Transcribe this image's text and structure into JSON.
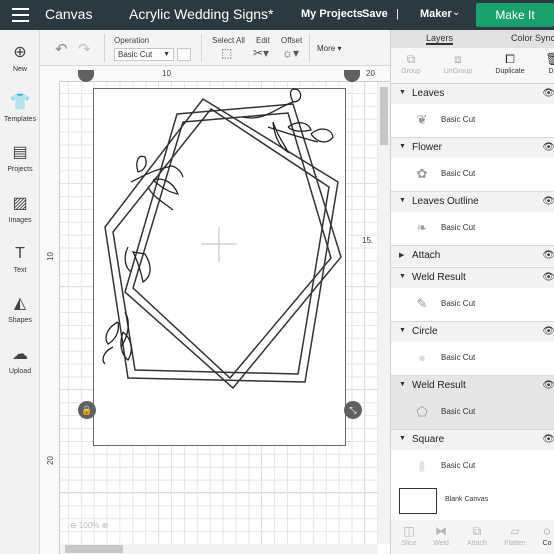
{
  "topbar": {
    "section_title": "Canvas",
    "document_title": "Acrylic Wedding Signs*",
    "my_projects": "My Projects",
    "save": "Save",
    "separator": "|",
    "machine": "Maker",
    "make_it": "Make It"
  },
  "toolbar": {
    "operation_label": "Operation",
    "operation_value": "Basic Cut",
    "select_all": "Select All",
    "edit": "Edit",
    "offset": "Offset",
    "more": "More"
  },
  "leftbar": {
    "items": [
      {
        "label": "New",
        "icon": "plus-circle-icon"
      },
      {
        "label": "Templates",
        "icon": "shirt-icon"
      },
      {
        "label": "Projects",
        "icon": "projects-icon"
      },
      {
        "label": "Images",
        "icon": "image-icon"
      },
      {
        "label": "Text",
        "icon": "text-icon"
      },
      {
        "label": "Shapes",
        "icon": "shapes-icon"
      },
      {
        "label": "Upload",
        "icon": "upload-icon"
      }
    ]
  },
  "rulers": {
    "top": [
      "10",
      "20"
    ],
    "left": [
      "10",
      "20"
    ]
  },
  "canvas": {
    "position_label": "15.",
    "zoom": "100%"
  },
  "panel": {
    "tabs": [
      "Layers",
      "Color Sync"
    ],
    "actions": [
      "Group",
      "UnGroup",
      "Duplicate",
      "De"
    ],
    "layers": [
      {
        "name": "Leaves",
        "operation": "Basic Cut",
        "expanded": true
      },
      {
        "name": "Flower",
        "operation": "Basic Cut",
        "expanded": true
      },
      {
        "name": "Leaves Outline",
        "operation": "Basic Cut",
        "expanded": true
      },
      {
        "name": "Attach",
        "operation": "",
        "expanded": false
      },
      {
        "name": "Weld Result",
        "operation": "Basic Cut",
        "expanded": true
      },
      {
        "name": "Circle",
        "operation": "Basic Cut",
        "expanded": true
      },
      {
        "name": "Weld Result",
        "operation": "Basic Cut",
        "expanded": true
      },
      {
        "name": "Square",
        "operation": "Basic Cut",
        "expanded": true
      }
    ],
    "blank_canvas": "Blank Canvas",
    "bottom_actions": [
      "Slice",
      "Weld",
      "Attach",
      "Flatten",
      "Co"
    ]
  }
}
